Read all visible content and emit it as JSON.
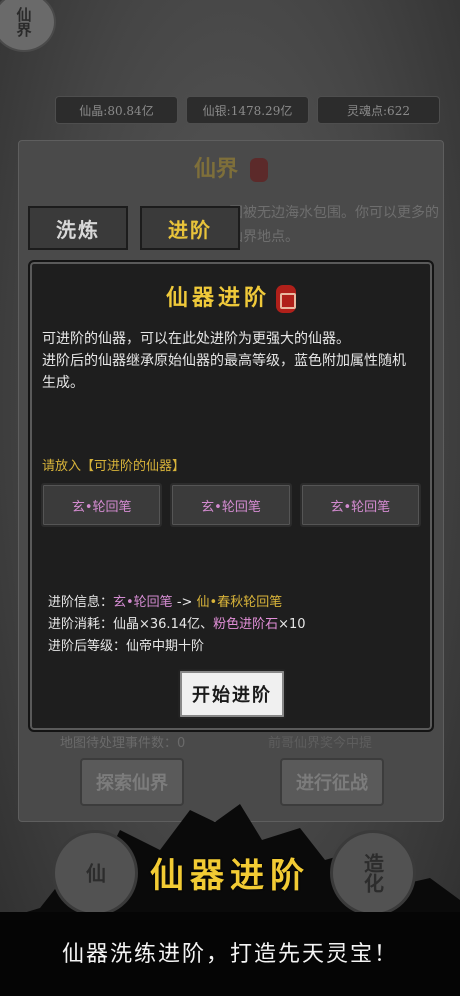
{
  "corner_seal": "仙界",
  "resources": [
    {
      "label": "仙晶:80.84亿"
    },
    {
      "label": "仙银:1478.29亿"
    },
    {
      "label": "灵魂点:622"
    }
  ],
  "panel": {
    "title": "仙界",
    "background_text": "国被无边海水包围。你可以更多的仙界地点。",
    "tabs": [
      {
        "label": "洗炼",
        "state": "inactive"
      },
      {
        "label": "进阶",
        "state": "active"
      }
    ],
    "pending_events": "地图待处理事件数：0",
    "right_under": "前哥仙界奖今中提",
    "buttons": {
      "explore": "探索仙界",
      "expedition": "进行征战"
    }
  },
  "dialog": {
    "title": "仙器进阶",
    "description_1": "可进阶的仙器，可以在此处进阶为更强大的仙器。",
    "description_2": "进阶后的仙器继承原始仙器的最高等级，蓝色附加属性随机生成。",
    "slot_label": "请放入【可进阶的仙器】",
    "slots": [
      "玄•轮回笔",
      "玄•轮回笔",
      "玄•轮回笔"
    ],
    "info": {
      "advance_label": "进阶信息：",
      "from_item": "玄•轮回笔",
      "arrow": " -> ",
      "to_item": "仙•春秋轮回笔",
      "cost_label": "进阶消耗：仙晶×36.14亿、",
      "cost_item": "粉色进阶石",
      "cost_qty": "×10",
      "level_line": "进阶后等级：仙帝中期十阶"
    },
    "start_button": "开始进阶"
  },
  "side_seals": {
    "left": "仙",
    "right": "造化"
  },
  "promo": {
    "title": "仙器进阶",
    "subtitle": "仙器洗练进阶，打造先天灵宝！"
  },
  "colors": {
    "gold": "#efc93a",
    "item_purple": "#d38bd0",
    "dialog_bg": "#1e1e1e"
  }
}
